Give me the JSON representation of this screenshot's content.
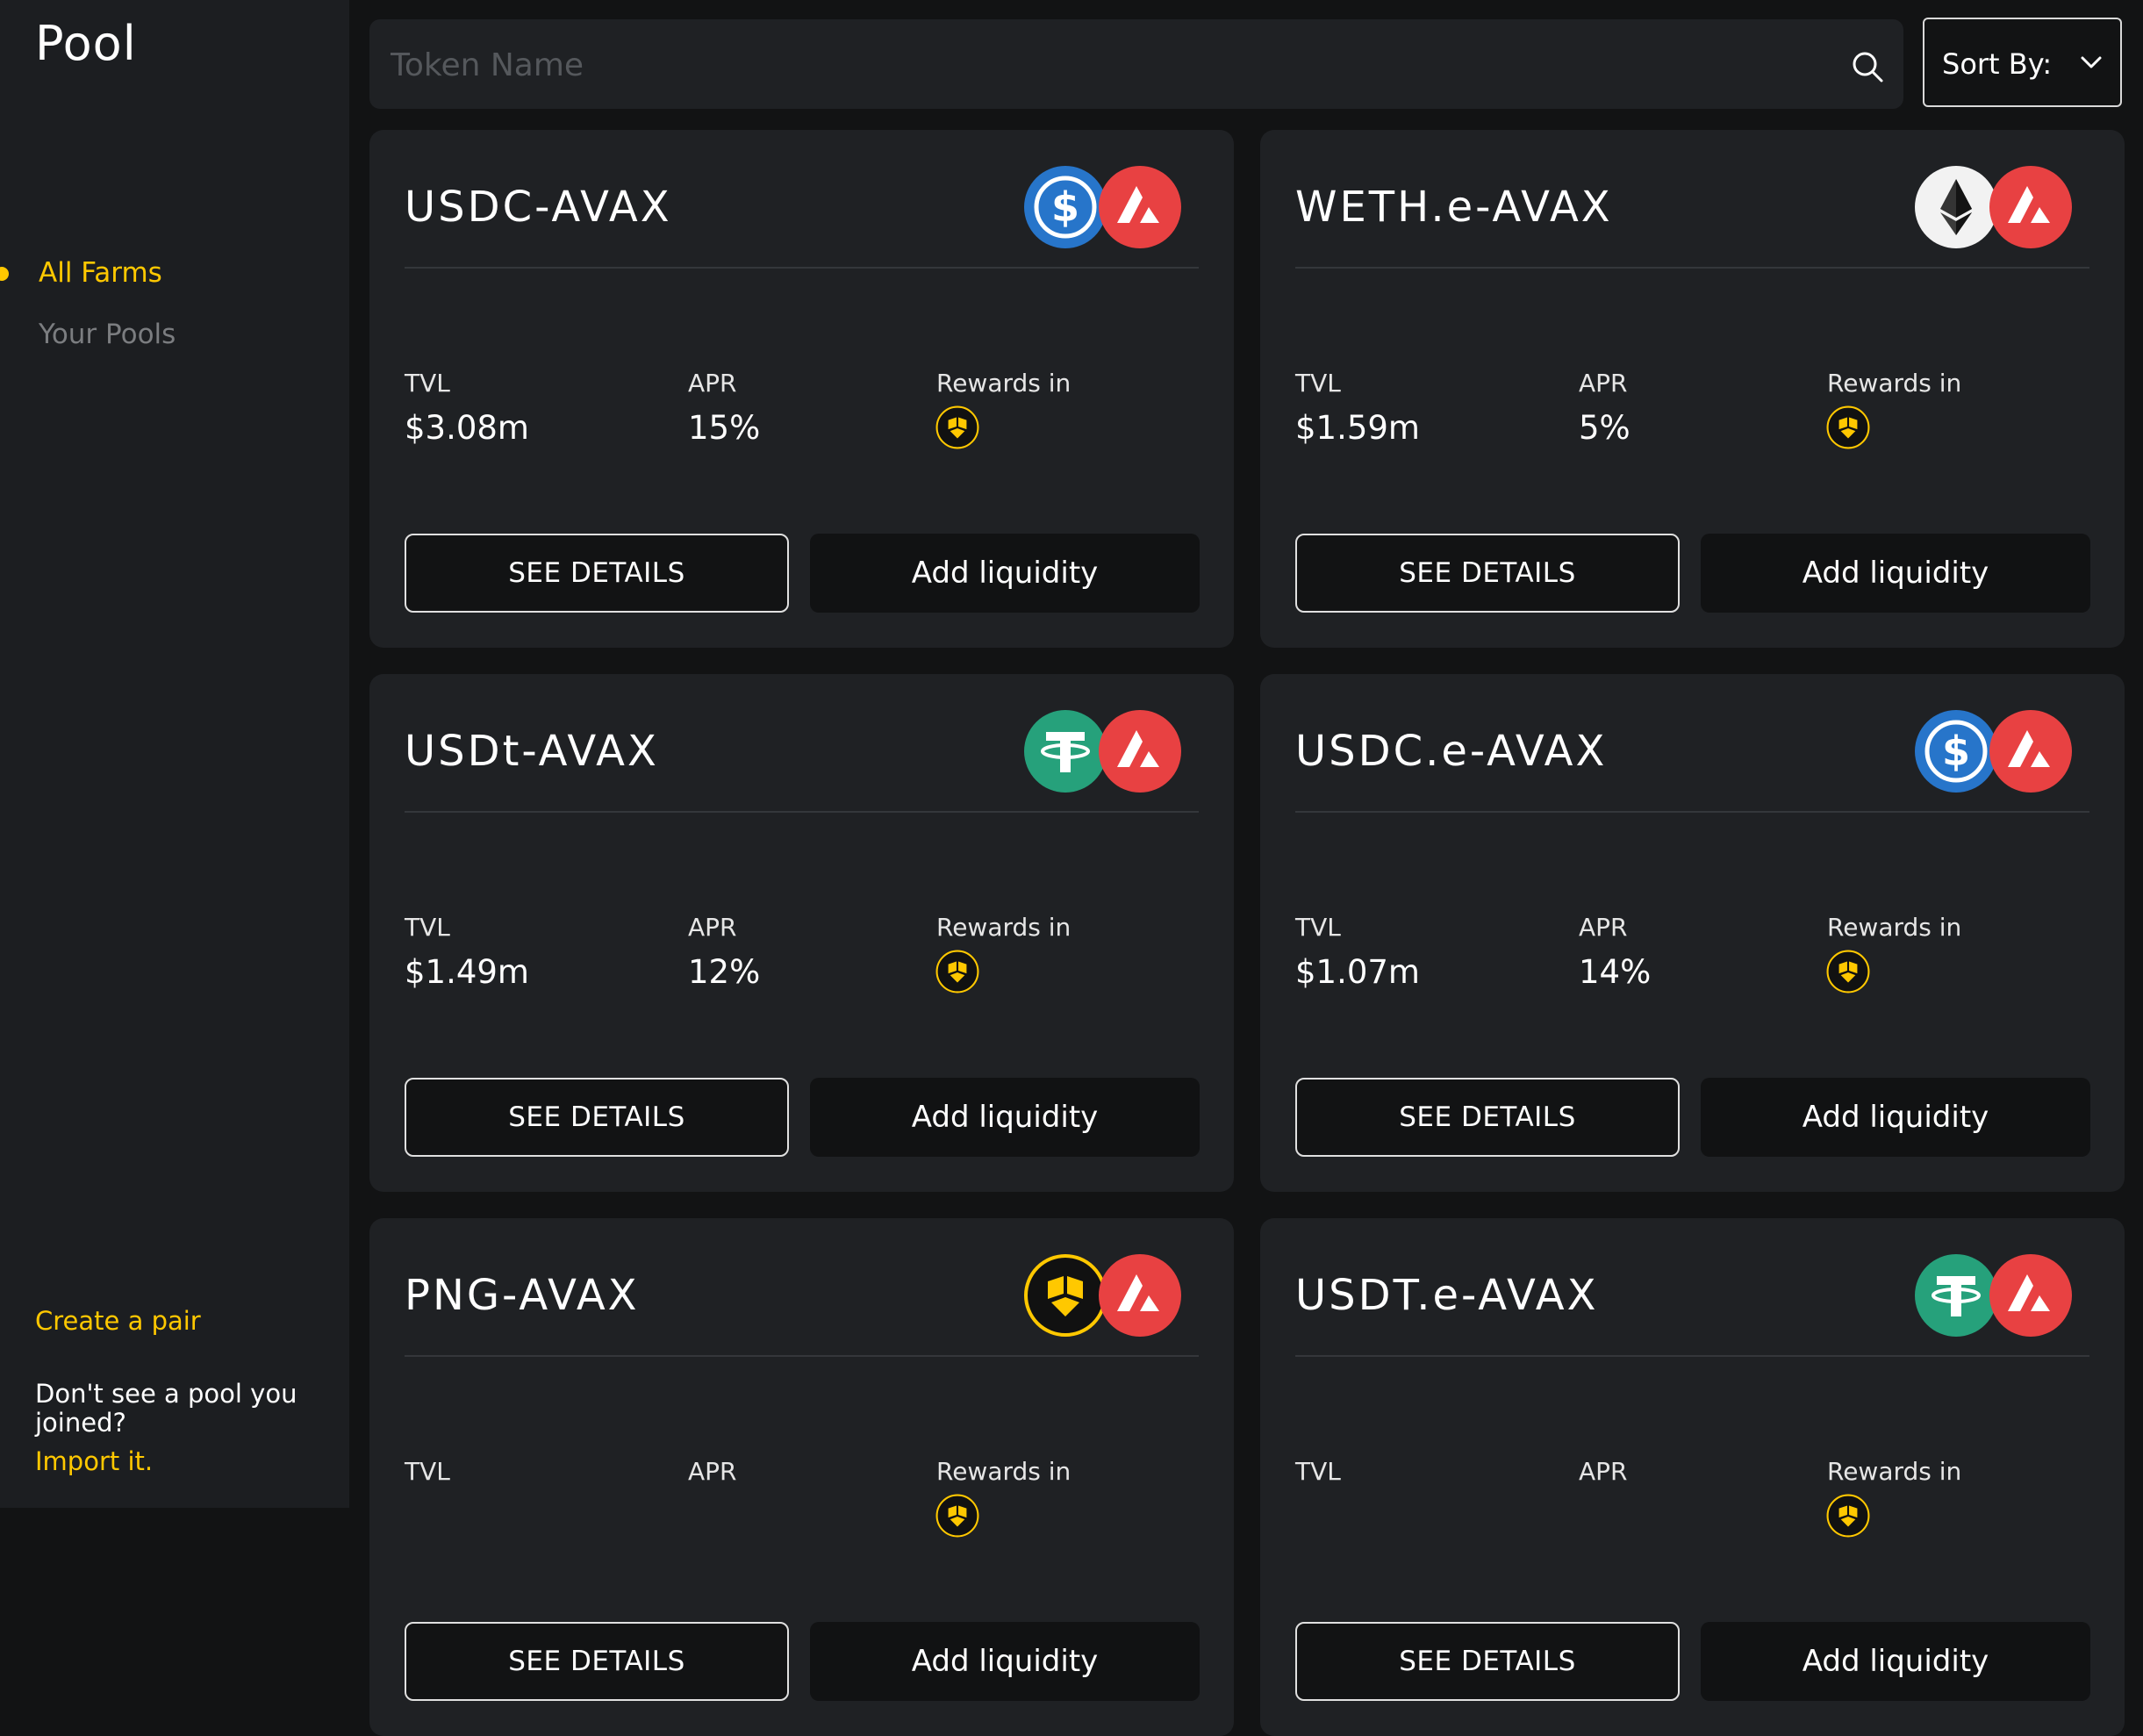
{
  "sidebar": {
    "title": "Pool",
    "nav": [
      {
        "label": "All Farms",
        "active": true
      },
      {
        "label": "Your Pools",
        "active": false
      }
    ],
    "create_pair": "Create a pair",
    "not_see": "Don't see a pool you joined?",
    "import_link": "Import it."
  },
  "search": {
    "placeholder": "Token Name",
    "value": ""
  },
  "sort": {
    "label": "Sort By:"
  },
  "labels": {
    "tvl": "TVL",
    "apr": "APR",
    "rewards": "Rewards in",
    "see_details": "SEE DETAILS",
    "add_liquidity": "Add liquidity"
  },
  "colors": {
    "accent": "#ffc800",
    "avax_red": "#e84142",
    "usdc_blue": "#2775ca",
    "tether_green": "#26a17b"
  },
  "pools": [
    {
      "name": "USDC-AVAX",
      "token_a_icon": "usdc-icon",
      "token_b_icon": "avax-icon",
      "tvl": "$3.08m",
      "apr": "15%",
      "reward_icon": "png-icon"
    },
    {
      "name": "WETH.e-AVAX",
      "token_a_icon": "eth-icon",
      "token_b_icon": "avax-icon",
      "tvl": "$1.59m",
      "apr": "5%",
      "reward_icon": "png-icon"
    },
    {
      "name": "USDt-AVAX",
      "token_a_icon": "tether-icon",
      "token_b_icon": "avax-icon",
      "tvl": "$1.49m",
      "apr": "12%",
      "reward_icon": "png-icon"
    },
    {
      "name": "USDC.e-AVAX",
      "token_a_icon": "usdc-icon",
      "token_b_icon": "avax-icon",
      "tvl": "$1.07m",
      "apr": "14%",
      "reward_icon": "png-icon"
    },
    {
      "name": "PNG-AVAX",
      "token_a_icon": "png-icon",
      "token_b_icon": "avax-icon",
      "tvl": "",
      "apr": "",
      "reward_icon": "png-icon"
    },
    {
      "name": "USDT.e-AVAX",
      "token_a_icon": "tether-icon",
      "token_b_icon": "avax-icon",
      "tvl": "",
      "apr": "",
      "reward_icon": "png-icon"
    }
  ]
}
